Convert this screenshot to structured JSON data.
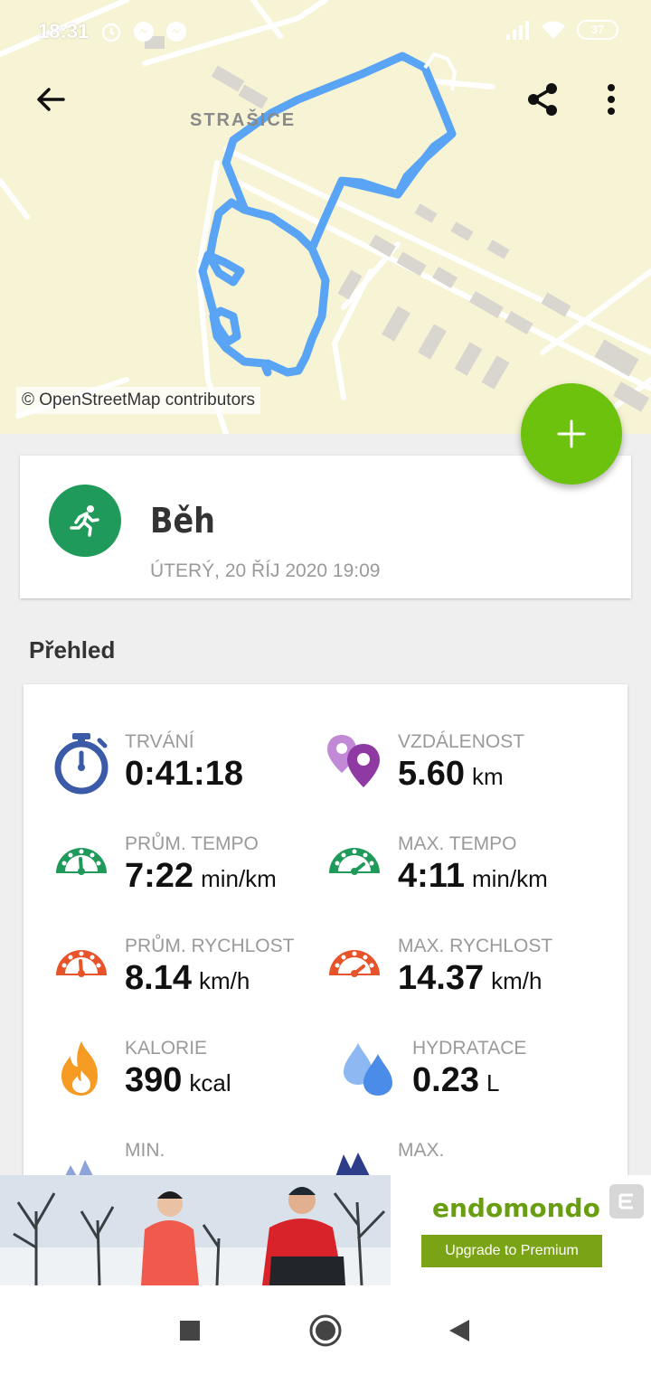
{
  "status_bar": {
    "time": "18:31",
    "battery": "37"
  },
  "map": {
    "place_label": "STRAŠICE",
    "attribution": "© OpenStreetMap contributors",
    "route_color": "#5aa4f5"
  },
  "activity": {
    "title": "Běh",
    "date": "ÚTERÝ, 20 ŘÍJ 2020 19:09",
    "icon": "running-person-icon",
    "color": "#1f9a5a"
  },
  "overview": {
    "title": "Přehled",
    "stats": [
      {
        "label": "TRVÁNÍ",
        "value": "0:41:18",
        "unit": "",
        "icon": "stopwatch-icon"
      },
      {
        "label": "VZDÁLENOST",
        "value": "5.60",
        "unit": "km",
        "icon": "location-pins-icon"
      },
      {
        "label": "PRŮM. TEMPO",
        "value": "7:22",
        "unit": "min/km",
        "icon": "gauge-icon"
      },
      {
        "label": "MAX. TEMPO",
        "value": "4:11",
        "unit": "min/km",
        "icon": "gauge-icon"
      },
      {
        "label": "PRŮM. RYCHLOST",
        "value": "8.14",
        "unit": "km/h",
        "icon": "speedometer-icon"
      },
      {
        "label": "MAX. RYCHLOST",
        "value": "14.37",
        "unit": "km/h",
        "icon": "speedometer-icon"
      },
      {
        "label": "KALORIE",
        "value": "390",
        "unit": "kcal",
        "icon": "flame-icon"
      },
      {
        "label": "HYDRATACE",
        "value": "0.23",
        "unit": "L",
        "icon": "water-drops-icon"
      },
      {
        "label": "MIN.",
        "value": "",
        "unit": "",
        "icon": "mountain-icon"
      },
      {
        "label": "MAX.",
        "value": "",
        "unit": "",
        "icon": "mountain-icon"
      }
    ]
  },
  "ad": {
    "brand": "endomondo",
    "button": "Upgrade to Premium"
  },
  "colors": {
    "fab": "#6cc20d",
    "accent_green": "#1f9a5a",
    "orange": "#e8542a"
  }
}
